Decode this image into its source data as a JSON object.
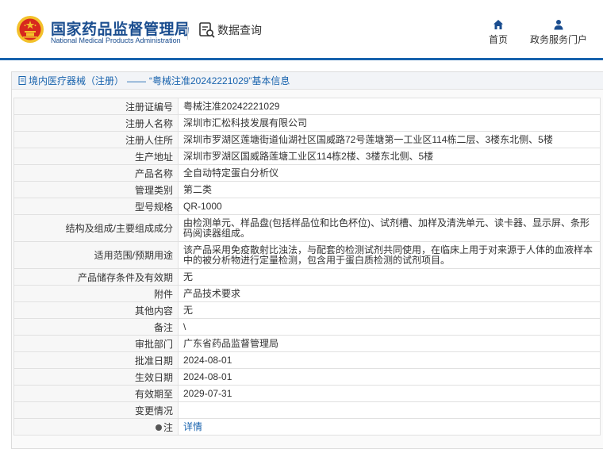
{
  "header": {
    "agency_cn": "国家药品监督管理局",
    "agency_en": "National Medical Products Administration",
    "query_label": "数据查询",
    "nav": {
      "home": "首页",
      "portal": "政务服务门户"
    }
  },
  "breadcrumb": {
    "section": "境内医疗器械（注册）",
    "separator": "——",
    "title": "“粤械注准20242221029”基本信息"
  },
  "rows": [
    {
      "label": "注册证编号",
      "value": "粤械注准20242221029"
    },
    {
      "label": "注册人名称",
      "value": "深圳市汇松科技发展有限公司"
    },
    {
      "label": "注册人住所",
      "value": "深圳市罗湖区莲塘街道仙湖社区国威路72号莲塘第一工业区114栋二层、3楼东北侧、5楼"
    },
    {
      "label": "生产地址",
      "value": "深圳市罗湖区国威路莲塘工业区114栋2楼、3楼东北侧、5楼"
    },
    {
      "label": "产品名称",
      "value": "全自动特定蛋白分析仪"
    },
    {
      "label": "管理类别",
      "value": "第二类"
    },
    {
      "label": "型号规格",
      "value": "QR-1000"
    },
    {
      "label": "结构及组成/主要组成成分",
      "value": "由检测单元、样品盘(包括样品位和比色杯位)、试剂槽、加样及清洗单元、读卡器、显示屏、条形码阅读器组成。"
    },
    {
      "label": "适用范围/预期用途",
      "value": "该产品采用免疫散射比浊法，与配套的检测试剂共同使用，在临床上用于对来源于人体的血液样本中的被分析物进行定量检测，包含用于蛋白质检测的试剂项目。"
    },
    {
      "label": "产品储存条件及有效期",
      "value": "无"
    },
    {
      "label": "附件",
      "value": "产品技术要求"
    },
    {
      "label": "其他内容",
      "value": "无"
    },
    {
      "label": "备注",
      "value": "\\"
    },
    {
      "label": "审批部门",
      "value": "广东省药品监督管理局"
    },
    {
      "label": "批准日期",
      "value": "2024-08-01"
    },
    {
      "label": "生效日期",
      "value": "2024-08-01"
    },
    {
      "label": "有效期至",
      "value": "2029-07-31"
    },
    {
      "label": "变更情况",
      "value": ""
    },
    {
      "label": "注",
      "value": "详情"
    }
  ],
  "colors": {
    "brand_blue": "#1762ad",
    "emblem_red": "#d7281e",
    "emblem_gold": "#f3c12b"
  },
  "icons": {
    "emblem": "national-emblem-icon",
    "query": "data-query-icon",
    "home": "home-icon",
    "portal": "user-icon",
    "breadcrumb": "document-icon",
    "note": "dot-icon"
  }
}
